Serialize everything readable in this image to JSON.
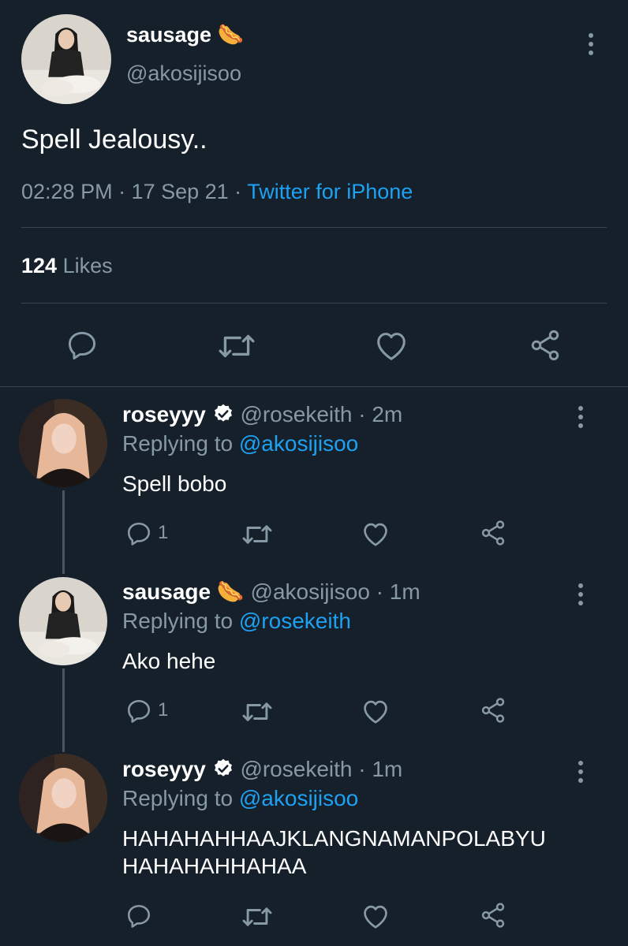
{
  "main_tweet": {
    "display_name": "sausage",
    "name_emoji": "🌭",
    "handle": "@akosijisoo",
    "text": "Spell Jealousy..",
    "timestamp": "02:28 PM · 17 Sep 21 · ",
    "source": "Twitter for iPhone",
    "likes_count": "124",
    "likes_label": "Likes"
  },
  "replies": [
    {
      "display_name": "roseyyy",
      "verified": true,
      "handle_time": "@rosekeith · 2m",
      "replying_prefix": "Replying to ",
      "replying_to": "@akosijisoo",
      "text": "Spell bobo",
      "reply_count": "1"
    },
    {
      "display_name": "sausage",
      "name_emoji": "🌭",
      "handle_time": "@akosijisoo · 1m",
      "replying_prefix": "Replying to ",
      "replying_to": "@rosekeith",
      "text": "Ako hehe",
      "reply_count": "1"
    },
    {
      "display_name": "roseyyy",
      "verified": true,
      "handle_time": "@rosekeith · 1m",
      "replying_prefix": "Replying to ",
      "replying_to": "@akosijisoo",
      "text_line1": "HAHAHAHHAAJKLANGNAMANPOLABYU",
      "text_line2": "HAHAHAHHAHAA",
      "reply_count": ""
    }
  ],
  "colors": {
    "background": "#15202b",
    "muted": "#8899a6",
    "link": "#1da1f2",
    "divider": "#38444d"
  }
}
